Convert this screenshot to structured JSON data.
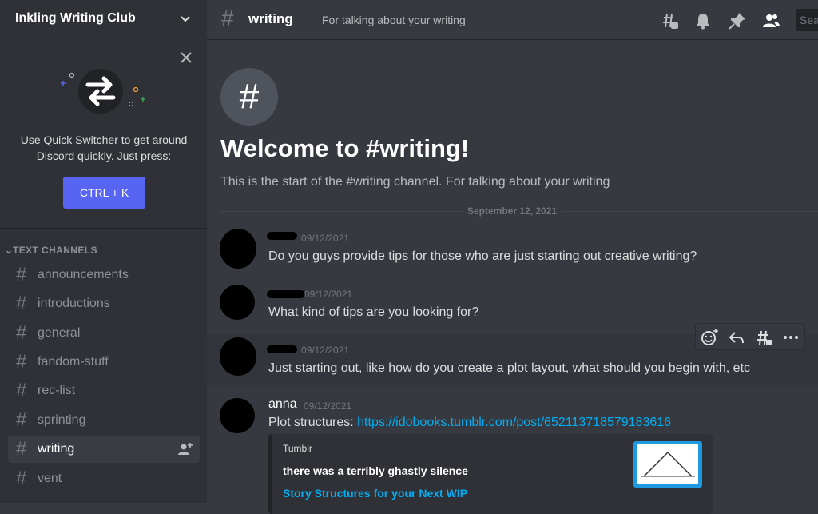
{
  "server": {
    "name": "Inkling Writing Club"
  },
  "quick_switcher": {
    "text": "Use Quick Switcher to get around Discord quickly. Just press:",
    "shortcut": "CTRL + K"
  },
  "category": {
    "label": "TEXT CHANNELS"
  },
  "channels": [
    {
      "name": "announcements",
      "active": false
    },
    {
      "name": "introductions",
      "active": false
    },
    {
      "name": "general",
      "active": false
    },
    {
      "name": "fandom-stuff",
      "active": false
    },
    {
      "name": "rec-list",
      "active": false
    },
    {
      "name": "sprinting",
      "active": false
    },
    {
      "name": "writing",
      "active": true
    },
    {
      "name": "vent",
      "active": false
    }
  ],
  "topbar": {
    "channel_name": "writing",
    "topic": "For talking about your writing",
    "search_placeholder": "Search",
    "icons": [
      "threads-icon",
      "bell-icon",
      "pin-icon",
      "members-icon"
    ]
  },
  "welcome": {
    "title": "Welcome to #writing!",
    "subtitle": "This is the start of the #writing channel. For talking about your writing"
  },
  "date_divider": "September 12, 2021",
  "messages": [
    {
      "author": "",
      "time": "09/12/2021",
      "text": "Do you guys provide tips for those who are just starting out creative writing?"
    },
    {
      "author": "",
      "time": "09/12/2021",
      "text": "What kind of tips are you looking for?"
    },
    {
      "author": "",
      "time": "09/12/2021",
      "text": "Just starting out, like how do you create a plot layout, what should you begin with, etc"
    },
    {
      "author": "anna",
      "time": "09/12/2021",
      "text": "Plot structures: ",
      "link": "https://idobooks.tumblr.com/post/652113718579183616"
    }
  ],
  "embed": {
    "provider": "Tumblr",
    "title": "there was a terribly ghastly silence",
    "link_text": "Story Structures for your Next WIP"
  },
  "colors": {
    "accent": "#5865f2",
    "link": "#00aff4",
    "background": "#36393f",
    "sidebar": "#2f3136"
  }
}
